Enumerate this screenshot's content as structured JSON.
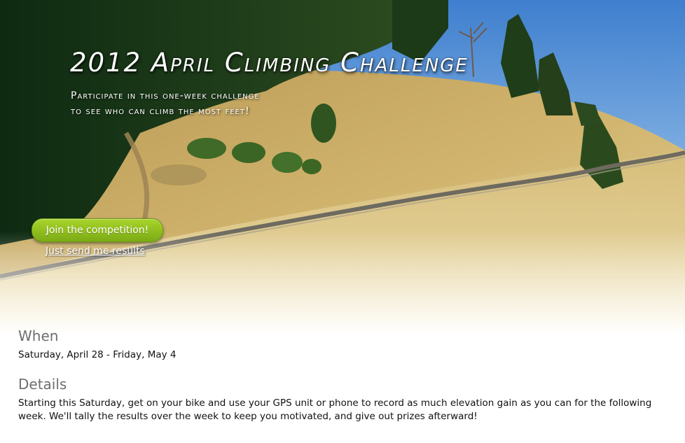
{
  "hero": {
    "title": "2012 April Climbing Challenge",
    "subtitle_lines": [
      "Participate in this one-week challenge",
      "to see who can climb the most feet!"
    ],
    "join_button_label": "Join the competition!",
    "results_link_label": "Just send me results",
    "image_description_icon": "hillside-photo"
  },
  "when": {
    "heading": "When",
    "text": "Saturday, April 28 - Friday, May 4"
  },
  "details": {
    "heading": "Details",
    "text": "Starting this Saturday, get on your bike and use your GPS unit or phone to record as much elevation gain as you can for the following week. We'll tally the results over the week to keep you motivated, and give out prizes afterward!"
  },
  "colors": {
    "button_green": "#8cbf1e",
    "heading_gray": "#6e6e6e",
    "sky_blue": "#4f8fd6",
    "grass_gold": "#c9ac62"
  }
}
